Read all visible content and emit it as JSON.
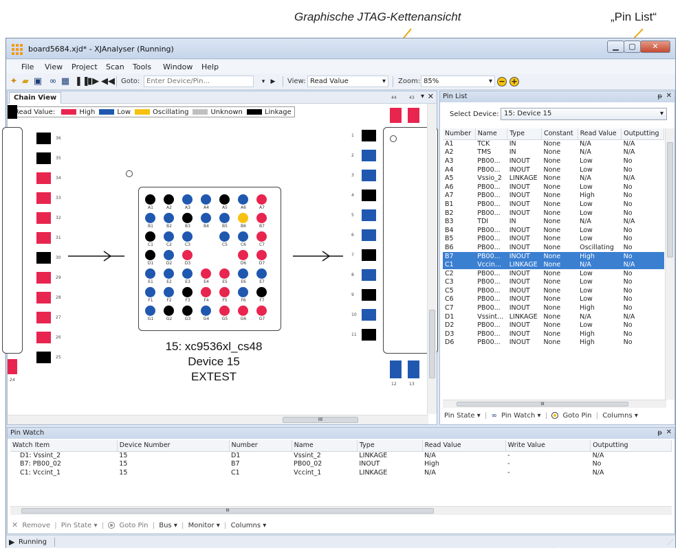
{
  "callouts": {
    "chain_view": "Graphische JTAG-Kettenansicht",
    "pin_list": "„Pin List“"
  },
  "window": {
    "title": "board5684.xjd* - XJAnalyser (Running)"
  },
  "menu": [
    "File",
    "View",
    "Project",
    "Scan",
    "Tools",
    "Window",
    "Help"
  ],
  "toolbar": {
    "goto_label": "Goto:",
    "goto_placeholder": "Enter Device/Pin...",
    "view_label": "View:",
    "view_value": "Read Value",
    "zoom_label": "Zoom:",
    "zoom_value": "85%"
  },
  "chain_view": {
    "tab": "Chain View",
    "legend": {
      "label": "Read Value:",
      "items": [
        {
          "name": "High",
          "color": "#e8254f"
        },
        {
          "name": "Low",
          "color": "#2058b0"
        },
        {
          "name": "Oscillating",
          "color": "#f6c20f"
        },
        {
          "name": "Unknown",
          "color": "#c0c0c0"
        },
        {
          "name": "Linkage",
          "color": "#000000"
        }
      ]
    },
    "left_pins": [
      {
        "n": "36",
        "c": "#000000"
      },
      {
        "n": "35",
        "c": "#000000"
      },
      {
        "n": "34",
        "c": "#e8254f"
      },
      {
        "n": "33",
        "c": "#e8254f"
      },
      {
        "n": "32",
        "c": "#e8254f"
      },
      {
        "n": "31",
        "c": "#e8254f"
      },
      {
        "n": "30",
        "c": "#000000"
      },
      {
        "n": "29",
        "c": "#e8254f"
      },
      {
        "n": "28",
        "c": "#e8254f"
      },
      {
        "n": "27",
        "c": "#e8254f"
      },
      {
        "n": "26",
        "c": "#e8254f"
      },
      {
        "n": "25",
        "c": "#000000"
      }
    ],
    "left_bottom_pin": {
      "n": "24",
      "c": "#e8254f"
    },
    "right_pins": [
      {
        "n": "1",
        "c": "#000000"
      },
      {
        "n": "2",
        "c": "#2058b0"
      },
      {
        "n": "3",
        "c": "#2058b0"
      },
      {
        "n": "4",
        "c": "#000000"
      },
      {
        "n": "5",
        "c": "#2058b0"
      },
      {
        "n": "6",
        "c": "#2058b0"
      },
      {
        "n": "7",
        "c": "#000000"
      },
      {
        "n": "8",
        "c": "#2058b0"
      },
      {
        "n": "9",
        "c": "#000000"
      },
      {
        "n": "10",
        "c": "#2058b0"
      },
      {
        "n": "11",
        "c": "#000000"
      }
    ],
    "right_top_pins": [
      {
        "n": "44",
        "c": "#e8254f"
      },
      {
        "n": "43",
        "c": "#e8254f"
      }
    ],
    "right_bottom_pins": [
      {
        "n": "12",
        "c": "#2058b0"
      },
      {
        "n": "13",
        "c": "#2058b0"
      }
    ],
    "bga_rows": [
      [
        {
          "l": "A1",
          "c": "#000000"
        },
        {
          "l": "A2",
          "c": "#000000"
        },
        {
          "l": "A3",
          "c": "#2058b0"
        },
        {
          "l": "A4",
          "c": "#2058b0"
        },
        {
          "l": "A5",
          "c": "#000000"
        },
        {
          "l": "A6",
          "c": "#2058b0"
        },
        {
          "l": "A7",
          "c": "#e8254f"
        }
      ],
      [
        {
          "l": "B1",
          "c": "#2058b0"
        },
        {
          "l": "B2",
          "c": "#2058b0"
        },
        {
          "l": "B3",
          "c": "#000000"
        },
        {
          "l": "B4",
          "c": "#2058b0"
        },
        {
          "l": "B5",
          "c": "#2058b0"
        },
        {
          "l": "B6",
          "c": "#f6c20f"
        },
        {
          "l": "B7",
          "c": "#e8254f"
        }
      ],
      [
        {
          "l": "C1",
          "c": "#000000"
        },
        {
          "l": "C2",
          "c": "#2058b0"
        },
        {
          "l": "C3",
          "c": "#2058b0"
        },
        null,
        {
          "l": "C5",
          "c": "#2058b0"
        },
        {
          "l": "C6",
          "c": "#2058b0"
        },
        {
          "l": "C7",
          "c": "#e8254f"
        }
      ],
      [
        {
          "l": "D1",
          "c": "#000000"
        },
        {
          "l": "D2",
          "c": "#2058b0"
        },
        {
          "l": "D3",
          "c": "#e8254f"
        },
        null,
        null,
        {
          "l": "D6",
          "c": "#e8254f"
        },
        {
          "l": "D7",
          "c": "#e8254f"
        }
      ],
      [
        {
          "l": "E1",
          "c": "#2058b0"
        },
        {
          "l": "E2",
          "c": "#2058b0"
        },
        {
          "l": "E3",
          "c": "#2058b0"
        },
        {
          "l": "E4",
          "c": "#e8254f"
        },
        {
          "l": "E5",
          "c": "#e8254f"
        },
        {
          "l": "E6",
          "c": "#2058b0"
        },
        {
          "l": "E7",
          "c": "#2058b0"
        }
      ],
      [
        {
          "l": "F1",
          "c": "#2058b0"
        },
        {
          "l": "F2",
          "c": "#2058b0"
        },
        {
          "l": "F3",
          "c": "#000000"
        },
        {
          "l": "F4",
          "c": "#e8254f"
        },
        {
          "l": "F5",
          "c": "#e8254f"
        },
        {
          "l": "F6",
          "c": "#2058b0"
        },
        {
          "l": "F7",
          "c": "#000000"
        }
      ],
      [
        {
          "l": "G1",
          "c": "#2058b0"
        },
        {
          "l": "G2",
          "c": "#000000"
        },
        {
          "l": "G3",
          "c": "#000000"
        },
        {
          "l": "G4",
          "c": "#2058b0"
        },
        {
          "l": "G5",
          "c": "#e8254f"
        },
        {
          "l": "G6",
          "c": "#e8254f"
        },
        {
          "l": "G7",
          "c": "#e8254f"
        }
      ]
    ],
    "device_line1": "15: xc9536xl_cs48",
    "device_line2": "Device 15",
    "device_line3": "EXTEST"
  },
  "pin_list": {
    "title": "Pin List",
    "select_label": "Select Device:",
    "select_value": "15: Device 15",
    "columns": [
      "Number",
      "Name",
      "Type",
      "Constant",
      "Read Value",
      "Outputting"
    ],
    "rows": [
      [
        "A1",
        "TCK",
        "IN",
        "None",
        "N/A",
        "N/A"
      ],
      [
        "A2",
        "TMS",
        "IN",
        "None",
        "N/A",
        "N/A"
      ],
      [
        "A3",
        "PB00...",
        "INOUT",
        "None",
        "Low",
        "No"
      ],
      [
        "A4",
        "PB00...",
        "INOUT",
        "None",
        "Low",
        "No"
      ],
      [
        "A5",
        "Vssio_2",
        "LINKAGE",
        "None",
        "N/A",
        "N/A"
      ],
      [
        "A6",
        "PB00...",
        "INOUT",
        "None",
        "Low",
        "No"
      ],
      [
        "A7",
        "PB00...",
        "INOUT",
        "None",
        "High",
        "No"
      ],
      [
        "B1",
        "PB00...",
        "INOUT",
        "None",
        "Low",
        "No"
      ],
      [
        "B2",
        "PB00...",
        "INOUT",
        "None",
        "Low",
        "No"
      ],
      [
        "B3",
        "TDI",
        "IN",
        "None",
        "N/A",
        "N/A"
      ],
      [
        "B4",
        "PB00...",
        "INOUT",
        "None",
        "Low",
        "No"
      ],
      [
        "B5",
        "PB00...",
        "INOUT",
        "None",
        "Low",
        "No"
      ],
      [
        "B6",
        "PB00...",
        "INOUT",
        "None",
        "Oscillating",
        "No"
      ],
      [
        "B7",
        "PB00...",
        "INOUT",
        "None",
        "High",
        "No"
      ],
      [
        "C1",
        "Vccin...",
        "LINKAGE",
        "None",
        "N/A",
        "N/A"
      ],
      [
        "C2",
        "PB00...",
        "INOUT",
        "None",
        "Low",
        "No"
      ],
      [
        "C3",
        "PB00...",
        "INOUT",
        "None",
        "Low",
        "No"
      ],
      [
        "C5",
        "PB00...",
        "INOUT",
        "None",
        "Low",
        "No"
      ],
      [
        "C6",
        "PB00...",
        "INOUT",
        "None",
        "Low",
        "No"
      ],
      [
        "C7",
        "PB00...",
        "INOUT",
        "None",
        "High",
        "No"
      ],
      [
        "D1",
        "Vssint...",
        "LINKAGE",
        "None",
        "N/A",
        "N/A"
      ],
      [
        "D2",
        "PB00...",
        "INOUT",
        "None",
        "Low",
        "No"
      ],
      [
        "D3",
        "PB00...",
        "INOUT",
        "None",
        "High",
        "No"
      ],
      [
        "D6",
        "PB00...",
        "INOUT",
        "None",
        "High",
        "No"
      ]
    ],
    "selected_rows": [
      "B7",
      "C1"
    ],
    "bottom_bar": {
      "pin_state": "Pin State ▾",
      "pin_watch": "Pin Watch ▾",
      "goto_pin": "Goto Pin",
      "columns": "Columns ▾"
    }
  },
  "pin_watch": {
    "title": "Pin Watch",
    "columns": [
      "Watch Item",
      "Device Number",
      "Number",
      "Name",
      "Type",
      "Read Value",
      "Write Value",
      "Outputting"
    ],
    "rows": [
      [
        "D1: Vssint_2",
        "15",
        "D1",
        "Vssint_2",
        "LINKAGE",
        "N/A",
        "-",
        "N/A"
      ],
      [
        "B7: PB00_02",
        "15",
        "B7",
        "PB00_02",
        "INOUT",
        "High",
        "-",
        "No"
      ],
      [
        "C1: Vccint_1",
        "15",
        "C1",
        "Vccint_1",
        "LINKAGE",
        "N/A",
        "-",
        "N/A"
      ]
    ],
    "bottom_bar": {
      "remove": "Remove",
      "pin_state": "Pin State ▾",
      "goto_pin": "Goto Pin",
      "bus": "Bus ▾",
      "monitor": "Monitor ▾",
      "columns": "Columns ▾"
    }
  },
  "status": {
    "text": "Running"
  },
  "scroll_marker": "III"
}
